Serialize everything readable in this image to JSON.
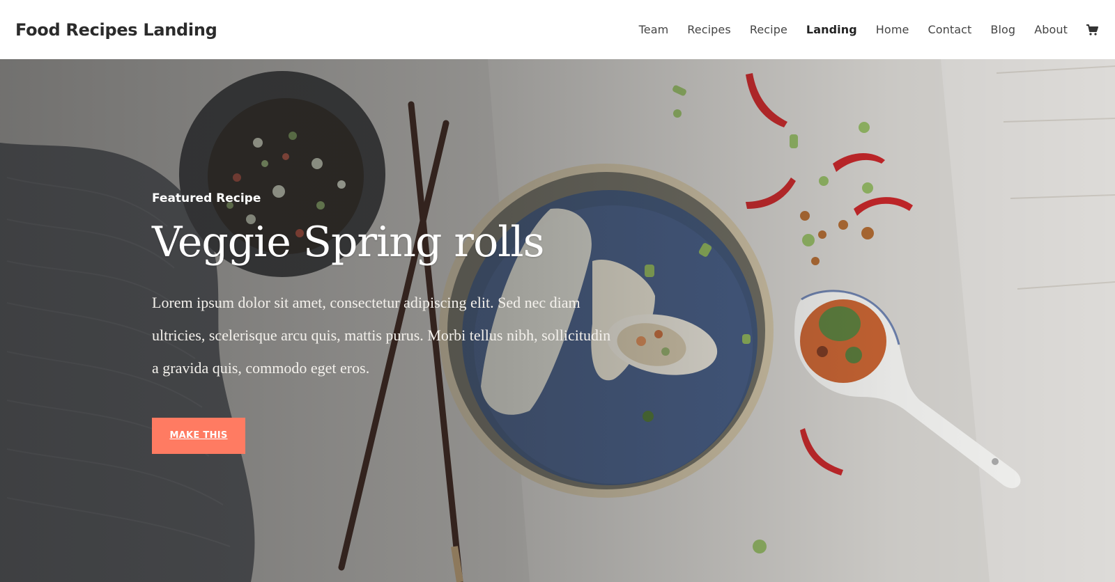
{
  "site": {
    "title": "Food Recipes Landing"
  },
  "nav": {
    "items": [
      "Team",
      "Recipes",
      "Recipe",
      "Landing",
      "Home",
      "Contact",
      "Blog",
      "About"
    ],
    "active": "Landing",
    "cart_icon": "cart-icon"
  },
  "hero": {
    "eyebrow": "Featured Recipe",
    "title": "Veggie Spring rolls",
    "description": "Lorem ipsum dolor sit amet, consectetur adipiscing elit. Sed nec diam ultricies, scelerisque arcu quis, mattis purus. Morbi tellus nibh, sollicitudin a gravida quis, commodo eget eros.",
    "button_label": "MAKE THIS"
  },
  "colors": {
    "accent": "#ff7b62",
    "header_bg": "#ffffff",
    "text_dark": "#2b2b2b"
  }
}
